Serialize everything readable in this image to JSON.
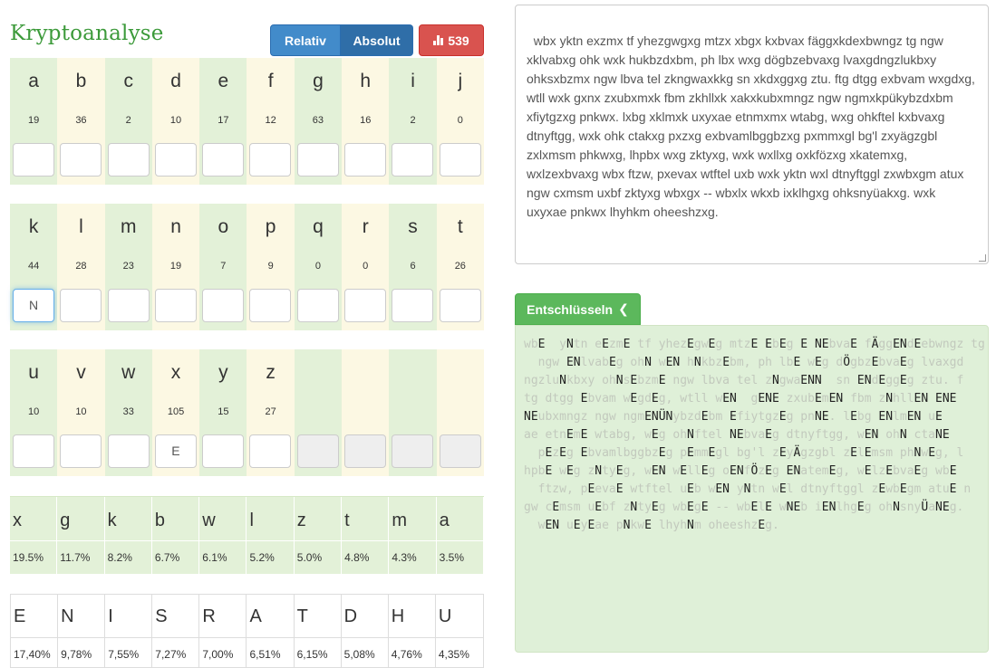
{
  "header": {
    "title": "Kryptoanalyse",
    "relative_label": "Relativ",
    "absolute_label": "Absolut",
    "count_label": "539",
    "count_icon": "bar-chart-icon"
  },
  "letter_rows": [
    {
      "letters": [
        "a",
        "b",
        "c",
        "d",
        "e",
        "f",
        "g",
        "h",
        "i",
        "j"
      ],
      "counts": [
        "19",
        "36",
        "2",
        "10",
        "17",
        "12",
        "63",
        "16",
        "2",
        "0"
      ],
      "inputs": [
        "",
        "",
        "",
        "",
        "",
        "",
        "",
        "",
        "",
        ""
      ]
    },
    {
      "letters": [
        "k",
        "l",
        "m",
        "n",
        "o",
        "p",
        "q",
        "r",
        "s",
        "t"
      ],
      "counts": [
        "44",
        "28",
        "23",
        "19",
        "7",
        "9",
        "0",
        "0",
        "6",
        "26"
      ],
      "inputs": [
        "N",
        "",
        "",
        "",
        "",
        "",
        "",
        "",
        "",
        ""
      ]
    },
    {
      "letters": [
        "u",
        "v",
        "w",
        "x",
        "y",
        "z"
      ],
      "counts": [
        "10",
        "10",
        "33",
        "105",
        "15",
        "27"
      ],
      "inputs": [
        "",
        "",
        "",
        "E",
        "",
        ""
      ]
    }
  ],
  "cipher_frequency": {
    "letters": [
      "x",
      "g",
      "k",
      "b",
      "w",
      "l",
      "z",
      "t",
      "m",
      "a"
    ],
    "percents": [
      "19.5%",
      "11.7%",
      "8.2%",
      "6.7%",
      "6.1%",
      "5.2%",
      "5.0%",
      "4.8%",
      "4.3%",
      "3.5%"
    ]
  },
  "language_frequency": {
    "letters": [
      "E",
      "N",
      "I",
      "S",
      "R",
      "A",
      "T",
      "D",
      "H",
      "U"
    ],
    "percents": [
      "17,40%",
      "9,78%",
      "7,55%",
      "7,27%",
      "7,00%",
      "6,51%",
      "6,15%",
      "5,08%",
      "4,76%",
      "4,35%"
    ]
  },
  "ciphertext": "wbx yktn exzmx tf yhezgwgxg mtzx xbgx kxbvax fäggxkdexbwngz tg ngw xklvabxg ohk wxk hukbzdxbm, ph lbx wxg dögbzebvaxg lvaxgdngzlukbxy ohksxbzmx ngw lbva tel zkngwaxkkg sn xkdxggxg ztu. ftg dtgg exbvam wxgdxg, wtll wxk gxnx zxubxmxk fbm zkhllxk xakxkubxmngz ngw ngmxkpükybzdxbm xfiytgzxg pnkwx. lxbg xklmxk uxyxae etnmxmx wtabg, wxg ohkftel kxbvaxg dtnyftgg, wxk ohk ctakxg pxzxg exbvamlbggbzxg pxmmxgl bg'l zxyägzgbl zxlxmsm phkwxg, lhpbx wxg zktyxg, wxk wxllxg oxkfözxg xkatemxg, wxlzexbvaxg wbx ftzw, pxevax wtftel uxb wxk yktn wxl dtnyftggl zxwbxgm atux ngw cxmsm uxbf zktyxg wbxgx -- wbxlx wkxb ixklhgxg ohksnyüakxg. wxk uxyxae pnkwx lhyhkm oheeshzxg.",
  "decrypt_label": "Entschlüsseln",
  "decrypt_icon": "chevron-left-icon",
  "result_lines": [
    [
      [
        "wb",
        "c"
      ],
      [
        "E",
        "p"
      ],
      [
        "  y",
        "c"
      ],
      [
        "N",
        "p"
      ],
      [
        "tn e",
        "c"
      ],
      [
        "E",
        "p"
      ],
      [
        "zm",
        "c"
      ],
      [
        "E",
        "p"
      ],
      [
        " tf yhez",
        "c"
      ],
      [
        "E",
        "p"
      ],
      [
        "gw",
        "c"
      ],
      [
        "E",
        "p"
      ],
      [
        "g mtz",
        "c"
      ],
      [
        "E",
        "p"
      ],
      [
        " ",
        "c"
      ],
      [
        "E",
        "p"
      ],
      [
        "b",
        "c"
      ],
      [
        "E",
        "p"
      ],
      [
        "g ",
        "c"
      ],
      [
        "E",
        "p"
      ],
      [
        " ",
        "c"
      ],
      [
        "NE",
        "p"
      ],
      [
        "bva",
        "c"
      ],
      [
        "E",
        "p"
      ],
      [
        " f",
        "c"
      ],
      [
        "Ä",
        "p"
      ],
      [
        "gg",
        "c"
      ],
      [
        "E",
        "p"
      ],
      [
        "N",
        "p"
      ],
      [
        "d",
        "c"
      ],
      [
        "E",
        "p"
      ],
      [
        "ebwngz tg",
        "c"
      ]
    ],
    [
      [
        "  ngw ",
        "c"
      ],
      [
        "EN",
        "p"
      ],
      [
        "lvab",
        "c"
      ],
      [
        "E",
        "p"
      ],
      [
        "g oh",
        "c"
      ],
      [
        "N",
        "p"
      ],
      [
        " w",
        "c"
      ],
      [
        "EN",
        "p"
      ],
      [
        " h",
        "c"
      ],
      [
        "N",
        "p"
      ],
      [
        "kbz",
        "c"
      ],
      [
        "E",
        "p"
      ],
      [
        "bm, ph lb",
        "c"
      ],
      [
        "E",
        "p"
      ],
      [
        " w",
        "c"
      ],
      [
        "E",
        "p"
      ],
      [
        "g d",
        "c"
      ],
      [
        "Ö",
        "p"
      ],
      [
        "gbz",
        "c"
      ],
      [
        "E",
        "p"
      ],
      [
        "bva",
        "c"
      ],
      [
        "E",
        "p"
      ],
      [
        "g lvaxgd",
        "c"
      ]
    ],
    [
      [
        "ngzlu",
        "c"
      ],
      [
        "N",
        "p"
      ],
      [
        "kbxy oh",
        "c"
      ],
      [
        "N",
        "p"
      ],
      [
        "s",
        "c"
      ],
      [
        "E",
        "p"
      ],
      [
        "bzm",
        "c"
      ],
      [
        "E",
        "p"
      ],
      [
        " ngw lbva tel z",
        "c"
      ],
      [
        "N",
        "p"
      ],
      [
        "gwa",
        "c"
      ],
      [
        "ENN",
        "p"
      ],
      [
        "  sn ",
        "c"
      ],
      [
        "EN",
        "p"
      ],
      [
        "d",
        "c"
      ],
      [
        "E",
        "p"
      ],
      [
        "gg",
        "c"
      ],
      [
        "E",
        "p"
      ],
      [
        "g ztu. f",
        "c"
      ]
    ],
    [
      [
        "tg dtgg ",
        "c"
      ],
      [
        "E",
        "p"
      ],
      [
        "bvam w",
        "c"
      ],
      [
        "E",
        "p"
      ],
      [
        "gd",
        "c"
      ],
      [
        "E",
        "p"
      ],
      [
        "g, wtll w",
        "c"
      ],
      [
        "EN",
        "p"
      ],
      [
        "  g",
        "c"
      ],
      [
        "E",
        "p"
      ],
      [
        "N",
        "p"
      ],
      [
        "E",
        "p"
      ],
      [
        " zxub",
        "c"
      ],
      [
        "E",
        "p"
      ],
      [
        "m",
        "c"
      ],
      [
        "EN",
        "p"
      ],
      [
        " fbm z",
        "c"
      ],
      [
        "N",
        "p"
      ],
      [
        "hll",
        "c"
      ],
      [
        "EN",
        "p"
      ],
      [
        " ",
        "c"
      ],
      [
        "E",
        "p"
      ],
      [
        "NE",
        "p"
      ]
    ],
    [
      [
        "N",
        "p"
      ],
      [
        "E",
        "p"
      ],
      [
        "ubxmngz ngw ngm",
        "c"
      ],
      [
        "EN",
        "p"
      ],
      [
        "Ü",
        "p"
      ],
      [
        "N",
        "p"
      ],
      [
        "ybzd",
        "c"
      ],
      [
        "E",
        "p"
      ],
      [
        "bm ",
        "c"
      ],
      [
        "E",
        "p"
      ],
      [
        "fiytgz",
        "c"
      ],
      [
        "E",
        "p"
      ],
      [
        "g pn",
        "c"
      ],
      [
        "NE",
        "p"
      ],
      [
        ". l",
        "c"
      ],
      [
        "E",
        "p"
      ],
      [
        "bg ",
        "c"
      ],
      [
        "EN",
        "p"
      ],
      [
        "lm",
        "c"
      ],
      [
        "EN",
        "p"
      ],
      [
        " u",
        "c"
      ],
      [
        "E",
        "p"
      ]
    ],
    [
      [
        "ae etn",
        "c"
      ],
      [
        "E",
        "p"
      ],
      [
        "m",
        "c"
      ],
      [
        "E",
        "p"
      ],
      [
        " wtabg, w",
        "c"
      ],
      [
        "E",
        "p"
      ],
      [
        "g oh",
        "c"
      ],
      [
        "N",
        "p"
      ],
      [
        "ftel ",
        "c"
      ],
      [
        "NE",
        "p"
      ],
      [
        "bva",
        "c"
      ],
      [
        "E",
        "p"
      ],
      [
        "g dtnyftgg, w",
        "c"
      ],
      [
        "EN",
        "p"
      ],
      [
        " oh",
        "c"
      ],
      [
        "N",
        "p"
      ],
      [
        " cta",
        "c"
      ],
      [
        "NE",
        "p"
      ]
    ],
    [
      [
        "  p",
        "c"
      ],
      [
        "E",
        "p"
      ],
      [
        "z",
        "c"
      ],
      [
        "E",
        "p"
      ],
      [
        "g ",
        "c"
      ],
      [
        "E",
        "p"
      ],
      [
        "bvamlbggbz",
        "c"
      ],
      [
        "E",
        "p"
      ],
      [
        "g p",
        "c"
      ],
      [
        "E",
        "p"
      ],
      [
        "mm",
        "c"
      ],
      [
        "E",
        "p"
      ],
      [
        "gl bg'l z",
        "c"
      ],
      [
        "E",
        "p"
      ],
      [
        "y",
        "c"
      ],
      [
        "Ä",
        "p"
      ],
      [
        "gzgbl z",
        "c"
      ],
      [
        "E",
        "p"
      ],
      [
        "l",
        "c"
      ],
      [
        "E",
        "p"
      ],
      [
        "msm ph",
        "c"
      ],
      [
        "N",
        "p"
      ],
      [
        "w",
        "c"
      ],
      [
        "E",
        "p"
      ],
      [
        "g, l",
        "c"
      ]
    ],
    [
      [
        "hpb",
        "c"
      ],
      [
        "E",
        "p"
      ],
      [
        " w",
        "c"
      ],
      [
        "E",
        "p"
      ],
      [
        "g z",
        "c"
      ],
      [
        "N",
        "p"
      ],
      [
        "ty",
        "c"
      ],
      [
        "E",
        "p"
      ],
      [
        "g, w",
        "c"
      ],
      [
        "EN",
        "p"
      ],
      [
        " w",
        "c"
      ],
      [
        "E",
        "p"
      ],
      [
        "ll",
        "c"
      ],
      [
        "E",
        "p"
      ],
      [
        "g o",
        "c"
      ],
      [
        "EN",
        "p"
      ],
      [
        "f",
        "c"
      ],
      [
        "Ö",
        "p"
      ],
      [
        "z",
        "c"
      ],
      [
        "E",
        "p"
      ],
      [
        "g ",
        "c"
      ],
      [
        "EN",
        "p"
      ],
      [
        "atem",
        "c"
      ],
      [
        "E",
        "p"
      ],
      [
        "g, w",
        "c"
      ],
      [
        "E",
        "p"
      ],
      [
        "lz",
        "c"
      ],
      [
        "E",
        "p"
      ],
      [
        "bva",
        "c"
      ],
      [
        "E",
        "p"
      ],
      [
        "g wb",
        "c"
      ],
      [
        "E",
        "p"
      ]
    ],
    [
      [
        "  ftzw, p",
        "c"
      ],
      [
        "E",
        "p"
      ],
      [
        "eva",
        "c"
      ],
      [
        "E",
        "p"
      ],
      [
        " wtftel u",
        "c"
      ],
      [
        "E",
        "p"
      ],
      [
        "b w",
        "c"
      ],
      [
        "EN",
        "p"
      ],
      [
        " y",
        "c"
      ],
      [
        "N",
        "p"
      ],
      [
        "tn w",
        "c"
      ],
      [
        "E",
        "p"
      ],
      [
        "l dtnyftggl z",
        "c"
      ],
      [
        "E",
        "p"
      ],
      [
        "wb",
        "c"
      ],
      [
        "E",
        "p"
      ],
      [
        "gm atu",
        "c"
      ],
      [
        "E",
        "p"
      ],
      [
        " n",
        "c"
      ]
    ],
    [
      [
        "gw c",
        "c"
      ],
      [
        "E",
        "p"
      ],
      [
        "msm u",
        "c"
      ],
      [
        "E",
        "p"
      ],
      [
        "bf z",
        "c"
      ],
      [
        "N",
        "p"
      ],
      [
        "ty",
        "c"
      ],
      [
        "E",
        "p"
      ],
      [
        "g wb",
        "c"
      ],
      [
        "E",
        "p"
      ],
      [
        "g",
        "c"
      ],
      [
        "E",
        "p"
      ],
      [
        " -- wb",
        "c"
      ],
      [
        "E",
        "p"
      ],
      [
        "l",
        "c"
      ],
      [
        "E",
        "p"
      ],
      [
        " w",
        "c"
      ],
      [
        "NE",
        "p"
      ],
      [
        "b i",
        "c"
      ],
      [
        "EN",
        "p"
      ],
      [
        "lhg",
        "c"
      ],
      [
        "E",
        "p"
      ],
      [
        "g oh",
        "c"
      ],
      [
        "N",
        "p"
      ],
      [
        "sny",
        "c"
      ],
      [
        "Ü",
        "p"
      ],
      [
        "a",
        "c"
      ],
      [
        "NE",
        "p"
      ],
      [
        "g.",
        "c"
      ]
    ],
    [
      [
        "  w",
        "c"
      ],
      [
        "EN",
        "p"
      ],
      [
        " u",
        "c"
      ],
      [
        "E",
        "p"
      ],
      [
        "y",
        "c"
      ],
      [
        "E",
        "p"
      ],
      [
        "ae p",
        "c"
      ],
      [
        "N",
        "p"
      ],
      [
        "kw",
        "c"
      ],
      [
        "E",
        "p"
      ],
      [
        " lhyh",
        "c"
      ],
      [
        "N",
        "p"
      ],
      [
        "m oheeshz",
        "c"
      ],
      [
        "E",
        "p"
      ],
      [
        "g.",
        "c"
      ]
    ]
  ]
}
